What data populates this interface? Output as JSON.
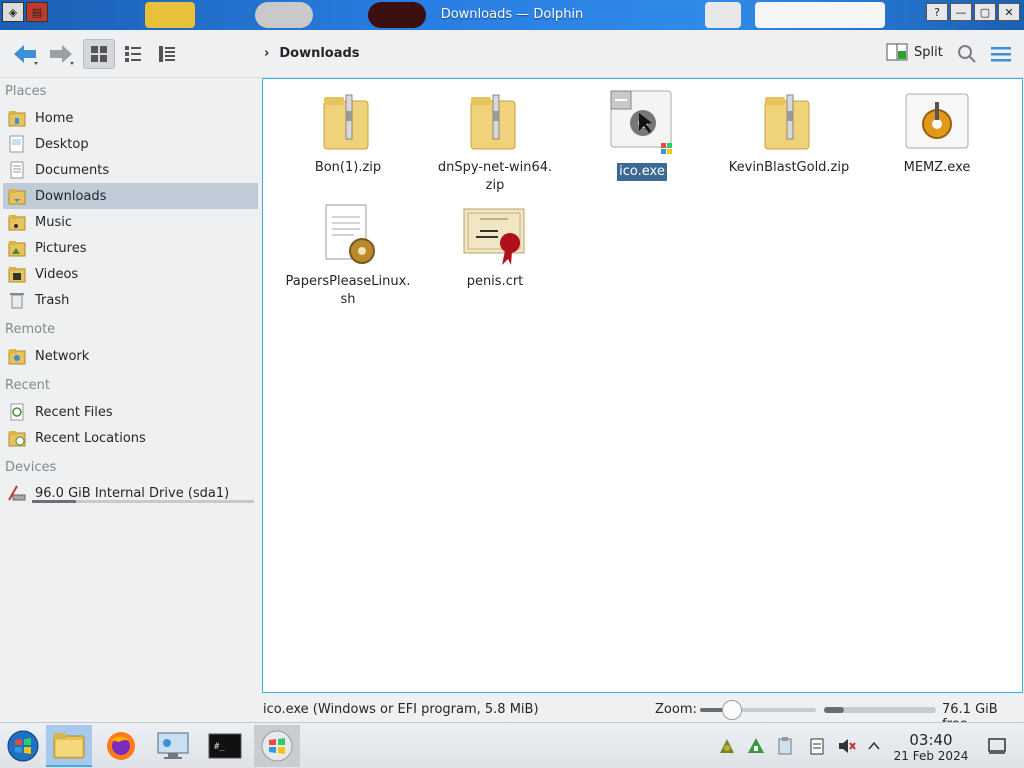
{
  "window": {
    "title": "Downloads — Dolphin"
  },
  "toolbar": {
    "breadcrumb": "Downloads",
    "split_label": "Split"
  },
  "sidebar": {
    "places_title": "Places",
    "places": [
      {
        "label": "Home",
        "icon": "home-folder-icon"
      },
      {
        "label": "Desktop",
        "icon": "desktop-icon"
      },
      {
        "label": "Documents",
        "icon": "documents-icon"
      },
      {
        "label": "Downloads",
        "icon": "downloads-folder-icon",
        "selected": true
      },
      {
        "label": "Music",
        "icon": "music-folder-icon"
      },
      {
        "label": "Pictures",
        "icon": "pictures-folder-icon"
      },
      {
        "label": "Videos",
        "icon": "videos-folder-icon"
      },
      {
        "label": "Trash",
        "icon": "trash-icon"
      }
    ],
    "remote_title": "Remote",
    "remote": [
      {
        "label": "Network",
        "icon": "network-folder-icon"
      }
    ],
    "recent_title": "Recent",
    "recent": [
      {
        "label": "Recent Files",
        "icon": "recent-files-icon"
      },
      {
        "label": "Recent Locations",
        "icon": "recent-locations-icon"
      }
    ],
    "devices_title": "Devices",
    "devices": [
      {
        "label": "96.0 GiB Internal Drive (sda1)",
        "icon": "drive-icon",
        "used_fraction": 0.2
      }
    ]
  },
  "files": [
    {
      "name": "Bon(1).zip",
      "type": "zip"
    },
    {
      "name": "dnSpy-net-win64.zip",
      "line1": "dnSpy-net-win64.",
      "line2": "zip",
      "type": "zip"
    },
    {
      "name": "ico.exe",
      "type": "exe-selected",
      "selected": true
    },
    {
      "name": "KevinBlastGold.zip",
      "type": "zip"
    },
    {
      "name": "MEMZ.exe",
      "type": "exe"
    },
    {
      "name": "PapersPleaseLinux.sh",
      "line1": "PapersPleaseLinux.",
      "line2": "sh",
      "type": "script"
    },
    {
      "name": "penis.crt",
      "type": "certificate"
    }
  ],
  "status": {
    "selection_text": "ico.exe (Windows or EFI program, 5.8 MiB)",
    "zoom_label": "Zoom:",
    "zoom_fraction": 0.28,
    "free_space": "76.1 GiB free",
    "used_fraction": 0.18
  },
  "taskbar": {
    "apps": [
      {
        "name": "start-menu",
        "icon": "windows-logo-icon"
      },
      {
        "name": "dolphin",
        "icon": "folder-icon",
        "active": true
      },
      {
        "name": "firefox",
        "icon": "firefox-icon"
      },
      {
        "name": "system-settings",
        "icon": "settings-monitor-icon"
      },
      {
        "name": "terminal",
        "icon": "terminal-icon"
      },
      {
        "name": "wine",
        "icon": "windows-logo-icon",
        "running": true
      }
    ],
    "clock_time": "03:40",
    "clock_date": "21 Feb 2024"
  },
  "colors": {
    "accent": "#3daee9",
    "selection": "#3d6a92",
    "sidebar_selected": "#bfccd8"
  }
}
